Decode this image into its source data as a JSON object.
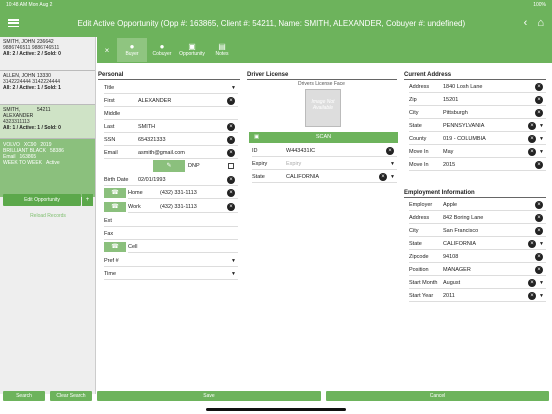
{
  "status": {
    "time": "10:48 AM",
    "date": "Mon Aug 2",
    "battery": "100%"
  },
  "header": {
    "title": "Edit Active Opportunity (Opp #: 163865, Client #: 54211, Name: SMITH, ALEXANDER, Cobuyer #: undefined)"
  },
  "sidebar": {
    "cards": [
      {
        "name": "SMITH, JOHN",
        "id": "236642",
        "phone1": "9886746511",
        "phone2": "9886746511",
        "status": "All: 2 / Active: 2 / Sold: 0"
      },
      {
        "name": "ALLEN, JOHN",
        "id": "13330",
        "phone1": "3142224444",
        "phone2": "3142224444",
        "status": "All: 2 / Active: 1 / Sold: 1"
      },
      {
        "name": "SMITH, ALEXANDER",
        "id": "54211",
        "phone1": "4323311113",
        "phone2": "",
        "status": "All: 1 / Active: 1 / Sold: 0"
      }
    ],
    "vehicle": {
      "make": "VOLVO",
      "model": "XC90",
      "year": "2019",
      "color": "BRILLIANT BLACK",
      "stock": "58386",
      "email": "Email",
      "opp": "163865",
      "week": "WEEK TO WEEK",
      "state": "Active"
    },
    "edit_label": "Edit Opportunity",
    "plus": "+",
    "reload": "Reload Records"
  },
  "tabs": [
    {
      "label": "Buyer",
      "icon": "person"
    },
    {
      "label": "Cobuyer",
      "icon": "person"
    },
    {
      "label": "Opportunity",
      "icon": "car"
    },
    {
      "label": "Notes",
      "icon": "doc"
    }
  ],
  "personal": {
    "title": "Personal",
    "title_field": {
      "label": "Title",
      "value": ""
    },
    "first": {
      "label": "First",
      "value": "ALEXANDER"
    },
    "middle": {
      "label": "Middle",
      "value": ""
    },
    "last": {
      "label": "Last",
      "value": "SMITH"
    },
    "ssn": {
      "label": "SSN",
      "value": "654321333"
    },
    "email": {
      "label": "Email",
      "value": "asmith@gmail.com"
    },
    "dnp": "DNP",
    "birth": {
      "label": "Birth Date",
      "value": "02/01/1993"
    },
    "home": {
      "label": "Home",
      "value": "(432) 331-1113"
    },
    "work": {
      "label": "Work",
      "value": "(432) 331-1113"
    },
    "ext": "Ext",
    "fax": "Fax",
    "cell": "Cell",
    "pref": "Pref #",
    "time": "Time"
  },
  "license": {
    "title": "Driver License",
    "face": "Drivers License Face",
    "photo": "Image Not Available",
    "scan": "SCAN",
    "id": {
      "label": "ID",
      "value": "W443431IC"
    },
    "expiry": {
      "label": "Expiry",
      "placeholder": "Expiry"
    },
    "state": {
      "label": "State",
      "value": "CALIFORNIA"
    }
  },
  "address": {
    "title": "Current Address",
    "fields": [
      {
        "label": "Address",
        "value": "1840 Losh Lane"
      },
      {
        "label": "Zip",
        "value": "15201"
      },
      {
        "label": "City",
        "value": "Pittsburgh"
      },
      {
        "label": "State",
        "value": "PENNSYLVANIA"
      },
      {
        "label": "County",
        "value": "019 - COLUMBIA"
      },
      {
        "label": "Move In",
        "value": "May"
      },
      {
        "label": "Move In",
        "value": "2015"
      }
    ]
  },
  "employment": {
    "title": "Employment Information",
    "fields": [
      {
        "label": "Employer",
        "value": "Apple"
      },
      {
        "label": "Address",
        "value": "842 Boring Lane"
      },
      {
        "label": "City",
        "value": "San Francisco"
      },
      {
        "label": "State",
        "value": "CALIFORNIA"
      },
      {
        "label": "Zipcode",
        "value": "94108"
      },
      {
        "label": "Position",
        "value": "MANAGER"
      },
      {
        "label": "Start Month",
        "value": "August"
      },
      {
        "label": "Start Year",
        "value": "2011"
      }
    ]
  },
  "footer": {
    "search": "Search",
    "clear": "Clear Search",
    "save": "Save",
    "cancel": "Cancel"
  }
}
